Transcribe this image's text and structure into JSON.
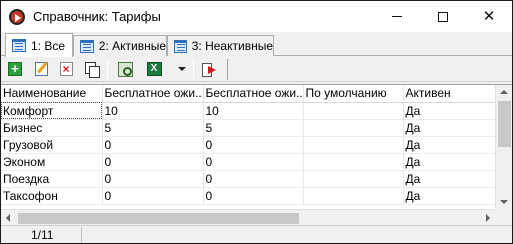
{
  "window": {
    "title": "Справочник:  Тарифы"
  },
  "tabs": [
    {
      "label": "1: Все",
      "active": true
    },
    {
      "label": "2: Активные",
      "active": false
    },
    {
      "label": "3: Неактивные",
      "active": false
    }
  ],
  "toolbar": {
    "buttons": [
      {
        "icon": "add-record-icon"
      },
      {
        "icon": "edit-record-icon"
      },
      {
        "icon": "delete-record-icon"
      },
      {
        "icon": "copy-record-icon"
      },
      {
        "icon": "properties-icon"
      },
      {
        "icon": "excel-export-icon"
      },
      {
        "icon": "dropdown-caret-icon"
      },
      {
        "icon": "exit-icon"
      }
    ]
  },
  "grid": {
    "columns": [
      "Наименование",
      "Бесплатное ожи...",
      "Бесплатное ожи...",
      "По умолчанию",
      "Активен"
    ],
    "rows": [
      [
        "Комфорт",
        "10",
        "10",
        "",
        "Да"
      ],
      [
        "Бизнес",
        "5",
        "5",
        "",
        "Да"
      ],
      [
        "Грузовой",
        "0",
        "0",
        "",
        "Да"
      ],
      [
        "Эконом",
        "0",
        "0",
        "",
        "Да"
      ],
      [
        "Поездка",
        "0",
        "0",
        "",
        "Да"
      ],
      [
        "Таксофон",
        "0",
        "0",
        "",
        "Да"
      ]
    ],
    "selected_row": 0
  },
  "status": {
    "record_counter": "1/11"
  },
  "colors": {
    "window_border": "#1a1a1a",
    "chrome_bg": "#f0f0f0",
    "grid_bg": "#ffffff"
  }
}
